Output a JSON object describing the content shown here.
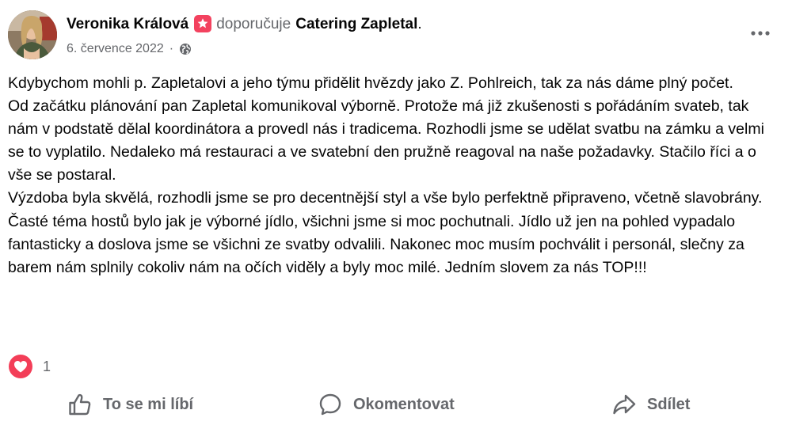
{
  "header": {
    "author": "Veronika Králová",
    "verb": "doporučuje",
    "page_name": "Catering Zapletal",
    "period": ".",
    "date": "6. července 2022",
    "separator": "·",
    "recommend_icon": "recommend-star-icon",
    "audience_icon": "globe-icon",
    "more_icon": "more-dots-icon"
  },
  "post": {
    "paragraphs": [
      "Kdybychom mohli p. Zapletalovi a jeho týmu přidělit hvězdy jako Z. Pohlreich, tak za nás dáme plný počet.",
      "Od začátku plánování pan Zapletal komunikoval výborně. Protože má již zkušenosti s pořádáním svateb, tak nám v podstatě dělal koordinátora a provedl nás i tradicema. Rozhodli jsme se udělat svatbu na zámku a velmi se to vyplatilo. Nedaleko má restauraci a ve svatební den pružně reagoval na naše požadavky. Stačilo říci a o vše se postaral.",
      "Výzdoba byla skvělá, rozhodli jsme se pro decentnější styl a vše bylo perfektně připraveno, včetně slavobrány. Časté téma hostů bylo jak je výborné jídlo, všichni jsme si moc pochutnali. Jídlo už jen na pohled vypadalo fantasticky a doslova jsme se všichni ze svatby odvalili. Nakonec moc musím pochválit i personál, slečny za barem nám splnily cokoliv nám na očích viděly a byly moc milé. Jedním slovem za nás TOP!!!"
    ]
  },
  "reactions": {
    "icon": "love-reaction-icon",
    "count": "1"
  },
  "actions": {
    "like": {
      "label": "To se mi líbí",
      "icon": "thumbs-up-icon"
    },
    "comment": {
      "label": "Okomentovat",
      "icon": "comment-bubble-icon"
    },
    "share": {
      "label": "Sdílet",
      "icon": "share-arrow-icon"
    }
  },
  "colors": {
    "text": "#050505",
    "secondary": "#65676b",
    "recommend": "#f3425f",
    "love": "#f33e58"
  }
}
